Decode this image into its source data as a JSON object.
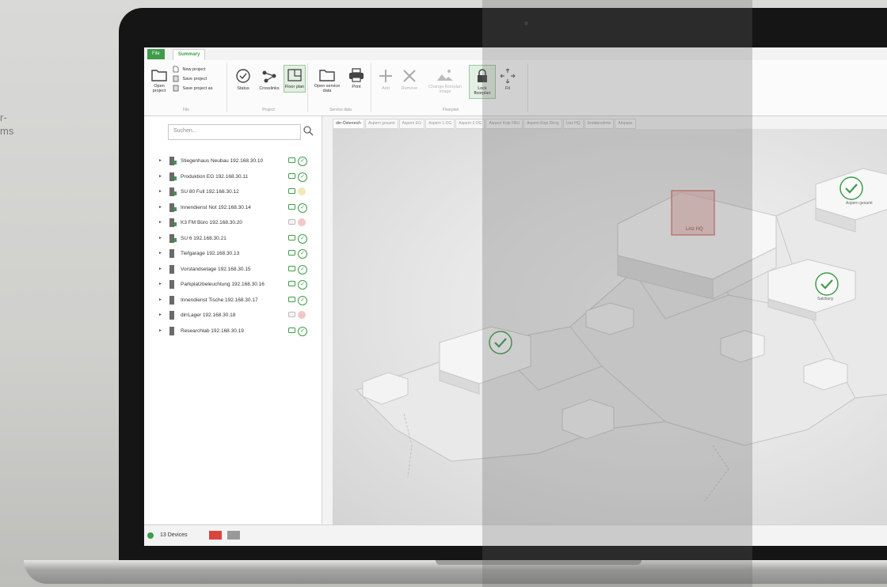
{
  "background": {
    "wall_text": [
      "r-",
      "ms"
    ]
  },
  "ribbon": {
    "tabs": [
      {
        "label": "File"
      },
      {
        "label": "Summary"
      }
    ],
    "file_group": {
      "label": "File",
      "open_label": "Open project",
      "new_project": "New project",
      "save_project": "Save project",
      "save_project_as": "Save project as"
    },
    "project_group": {
      "label": "Project",
      "status": "Status",
      "crosslinks": "Crosslinks",
      "floor_plan": "Floor plan"
    },
    "service_group": {
      "label": "Service data",
      "open_service": "Open service data",
      "print": "Print"
    },
    "floorplan_group": {
      "label": "Floorplan",
      "add": "Add",
      "remove": "Remove",
      "change_image": "Change floorplan image",
      "lock": "Lock floorplan",
      "fit": "Fit"
    }
  },
  "sidebar": {
    "search_placeholder": "Suchen...",
    "devices": [
      {
        "label": "Stiegenhaus Neubau 192.168.30.10",
        "status": "ok"
      },
      {
        "label": "Produktion EG 192.168.30.11",
        "status": "ok"
      },
      {
        "label": "SU 80 Full 192.168.30.12",
        "status": "warning"
      },
      {
        "label": "Innendienst Not 192.168.30.14",
        "status": "ok"
      },
      {
        "label": "K3 FM Büro 192.168.30.20",
        "status": "error"
      },
      {
        "label": "SU 6 192.168.30.21",
        "status": "ok"
      },
      {
        "label": "Tiefgarage 192.168.30.13",
        "status": "ok"
      },
      {
        "label": "Vorstandsetage 192.168.30.15",
        "status": "ok"
      },
      {
        "label": "Parkplatzbeleuchtung 192.168.30.16",
        "status": "ok"
      },
      {
        "label": "Innendienst Tische 192.168.30.17",
        "status": "ok"
      },
      {
        "label": "dirrLager 192.168.30.18",
        "status": "error"
      },
      {
        "label": "Researchlab 192.168.30.19",
        "status": "ok"
      }
    ]
  },
  "floorplan": {
    "tabs": [
      "dirr-Österreich",
      "Aspern gesamt",
      "Aspern EG",
      "Aspern 1.OG",
      "Aspern 2.OG",
      "Aspern Koje FBU",
      "Aspern Koje Dirng",
      "Linz HQ",
      "Endabnahme",
      "Ampass"
    ],
    "labels": {
      "linz_hq": "Linz HQ",
      "aspern_gesamt": "Aspern gesamt",
      "salzburg": "Salzburg"
    }
  },
  "status_bar": {
    "device_count": "13 Devices"
  },
  "colors": {
    "accent": "#3f9b4a",
    "error": "#d9453d",
    "warning": "#e8d98a"
  }
}
